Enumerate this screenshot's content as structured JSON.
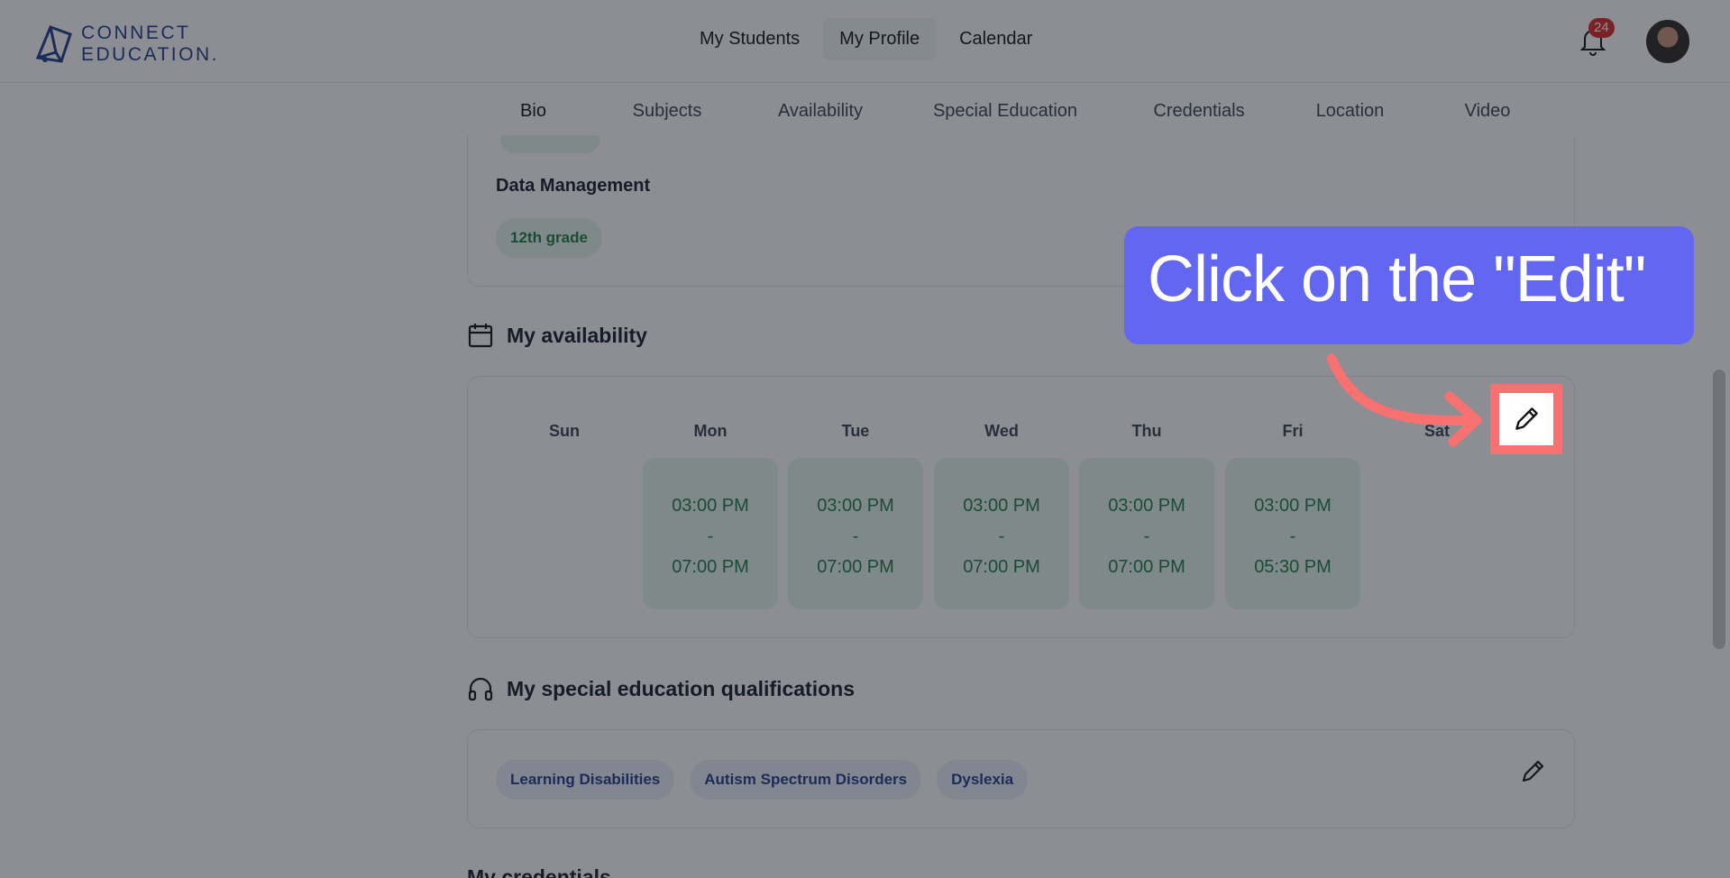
{
  "brand": {
    "name_line1": "CONNECT",
    "name_line2": "EDUCATION.",
    "icon": "connect-education-logo"
  },
  "nav": {
    "items": [
      "My Students",
      "My Profile",
      "Calendar"
    ],
    "active": "My Profile"
  },
  "notifications": {
    "count": "24",
    "icon": "bell-icon"
  },
  "tabs": {
    "items": [
      "Bio",
      "Subjects",
      "Availability",
      "Special Education",
      "Credentials",
      "Location",
      "Video"
    ],
    "active": "Bio"
  },
  "subjects": {
    "section_label": "Data Management",
    "grade_chip": "12th grade"
  },
  "availability": {
    "title": "My availability",
    "icon": "calendar-icon",
    "days": [
      "Sun",
      "Mon",
      "Tue",
      "Wed",
      "Thu",
      "Fri",
      "Sat"
    ],
    "slots": [
      {
        "day": "Mon",
        "start": "03:00 PM",
        "sep": "-",
        "end": "07:00 PM"
      },
      {
        "day": "Tue",
        "start": "03:00 PM",
        "sep": "-",
        "end": "07:00 PM"
      },
      {
        "day": "Wed",
        "start": "03:00 PM",
        "sep": "-",
        "end": "07:00 PM"
      },
      {
        "day": "Thu",
        "start": "03:00 PM",
        "sep": "-",
        "end": "07:00 PM"
      },
      {
        "day": "Fri",
        "start": "03:00 PM",
        "sep": "-",
        "end": "05:30 PM"
      }
    ],
    "edit_icon": "pencil-icon"
  },
  "special_education": {
    "title": "My special education qualifications",
    "icon": "headphones-icon",
    "chips": [
      "Learning Disabilities",
      "Autism Spectrum Disorders",
      "Dyslexia"
    ],
    "edit_icon": "pencil-icon"
  },
  "credentials": {
    "title": "My credentials"
  },
  "tutorial": {
    "callout_text": "Click on the \"Edit\"",
    "accent": "#6366f1",
    "highlight_color": "#f87171"
  }
}
